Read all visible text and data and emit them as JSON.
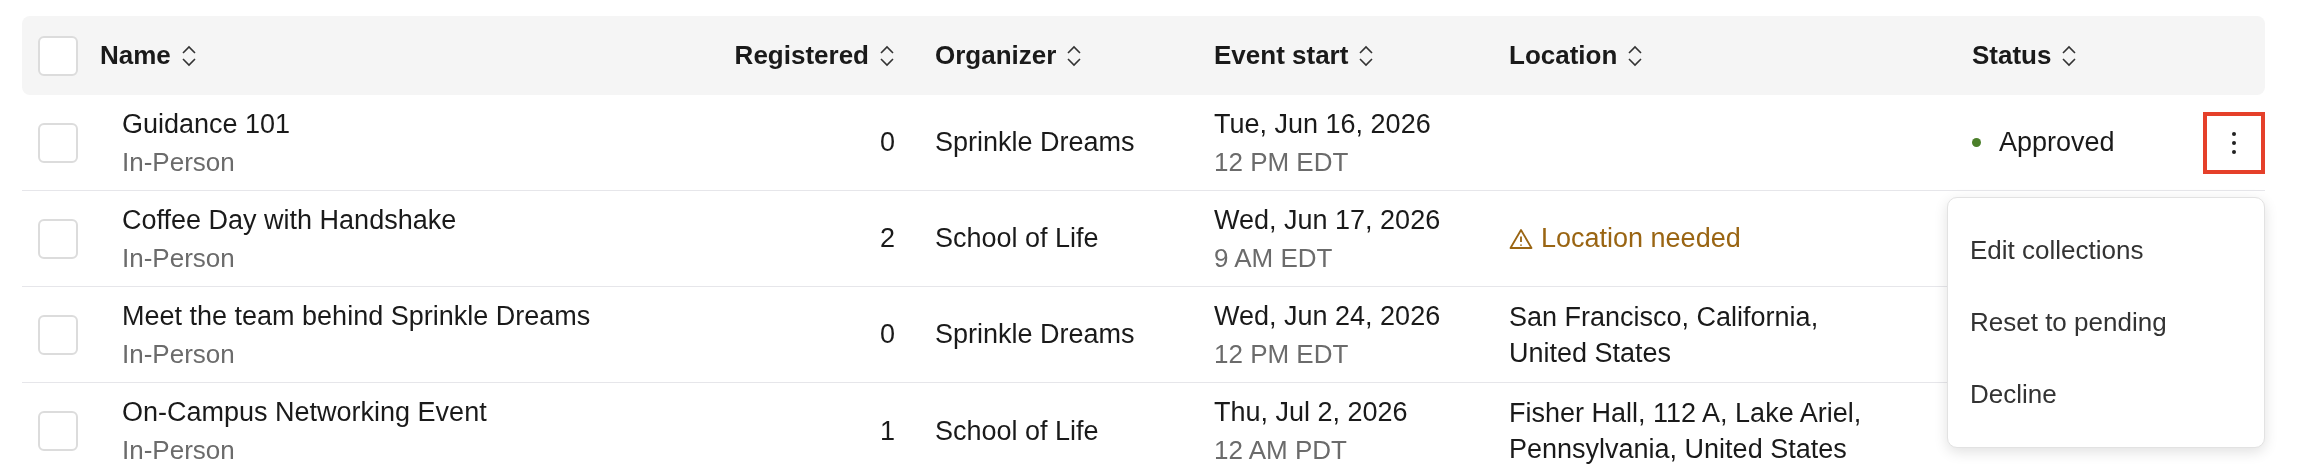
{
  "table": {
    "select_all": {
      "checked": false
    },
    "columns": [
      {
        "label": "Name"
      },
      {
        "label": "Registered"
      },
      {
        "label": "Organizer"
      },
      {
        "label": "Event start"
      },
      {
        "label": "Location"
      },
      {
        "label": "Status"
      }
    ],
    "rows": [
      {
        "checked": false,
        "name": "Guidance 101",
        "format": "In-Person",
        "registered": "0",
        "organizer": "Sprinkle Dreams",
        "date": "Tue, Jun 16, 2026",
        "time": "12 PM EDT",
        "status": {
          "label": "Approved",
          "color": "#4b7f2a"
        },
        "actions": {
          "highlighted": true
        }
      },
      {
        "checked": false,
        "name": "Coffee Day with Handshake",
        "format": "In-Person",
        "registered": "2",
        "organizer": "School of Life",
        "date": "Wed, Jun 17, 2026",
        "time": "9 AM EDT",
        "location": {
          "kind": "warning",
          "text": "Location needed"
        }
      },
      {
        "checked": false,
        "name": "Meet the team behind Sprinkle Dreams",
        "format": "In-Person",
        "registered": "0",
        "organizer": "Sprinkle Dreams",
        "date": "Wed, Jun 24, 2026",
        "time": "12 PM EDT",
        "location": {
          "kind": "address",
          "text": "San Francisco, California, United States"
        }
      },
      {
        "checked": false,
        "name": "On-Campus Networking Event",
        "format": "In-Person",
        "registered": "1",
        "organizer": "School of Life",
        "date": "Thu, Jul 2, 2026",
        "time": "12 AM PDT",
        "location": {
          "kind": "address",
          "text": "Fisher Hall, 112 A, Lake Ariel, Pennsylvania, United States"
        }
      }
    ]
  },
  "menu": {
    "open": true,
    "items": [
      {
        "label": "Edit collections"
      },
      {
        "label": "Reset to pending"
      },
      {
        "label": "Decline"
      }
    ]
  }
}
